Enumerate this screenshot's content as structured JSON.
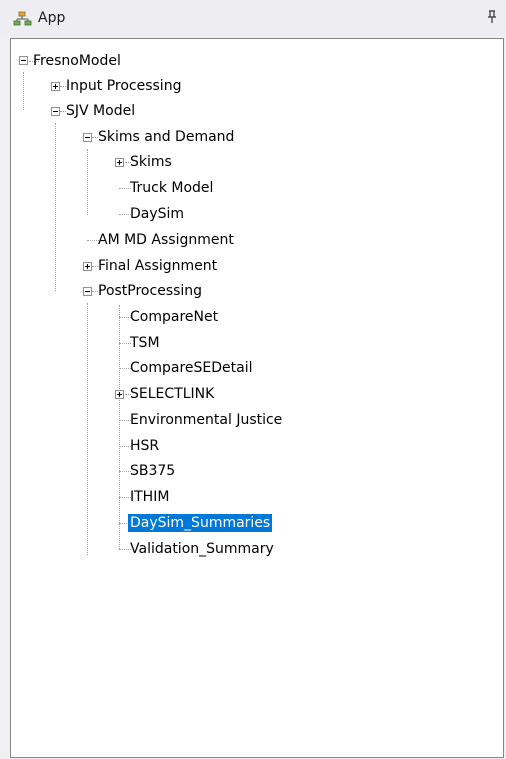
{
  "panel": {
    "title": "App"
  },
  "tree": {
    "root": "FresnoModel",
    "input_processing": "Input Processing",
    "sjv_model": "SJV Model",
    "skims_and_demand": "Skims and Demand",
    "skims": "Skims",
    "truck_model": "Truck Model",
    "daysim": "DaySim",
    "am_md_assignment": "AM MD Assignment",
    "final_assignment": "Final Assignment",
    "postprocessing": "PostProcessing",
    "comparenet": "CompareNet",
    "tsm": "TSM",
    "comparesedetail": "CompareSEDetail",
    "selectlink": "SELECTLINK",
    "environmental_justice": "Environmental Justice",
    "hsr": "HSR",
    "sb375": "SB375",
    "ithim": "ITHIM",
    "daysim_summaries": "DaySim_Summaries",
    "validation_summary": "Validation_Summary"
  },
  "selected_item": "DaySim_Summaries",
  "colors": {
    "selection": "#0078d7",
    "selection_text": "#ffffff",
    "titlebar": "#eeeef2"
  }
}
